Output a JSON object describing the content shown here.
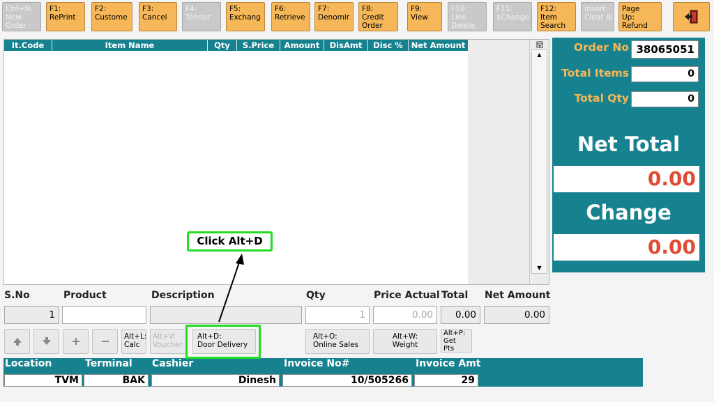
{
  "toolbar": [
    {
      "id": "new-order",
      "l1": "Ctrl+N:",
      "l2": "New",
      "l3": "Order",
      "disabled": true
    },
    {
      "id": "reprint",
      "l1": "F1:",
      "l2": "RePrint",
      "l3": "",
      "disabled": false
    },
    {
      "id": "customer",
      "l1": "F2:",
      "l2": "Custome",
      "l3": "",
      "disabled": false
    },
    {
      "id": "cancel",
      "l1": "F3:",
      "l2": "Cancel",
      "l3": "",
      "disabled": false
    },
    {
      "id": "tender",
      "l1": "F4:",
      "l2": "Tender",
      "l3": "",
      "disabled": true
    },
    {
      "id": "exchange",
      "l1": "F5:",
      "l2": "Exchang",
      "l3": "",
      "disabled": false
    },
    {
      "id": "retrieve",
      "l1": "F6:",
      "l2": "Retrieve",
      "l3": "",
      "disabled": false
    },
    {
      "id": "denomination",
      "l1": "F7:",
      "l2": "Denomir",
      "l3": "",
      "disabled": false
    },
    {
      "id": "credit-order",
      "l1": "F8:",
      "l2": "Credit",
      "l3": "Order",
      "disabled": false
    },
    {
      "id": "view",
      "l1": "F9:",
      "l2": "View",
      "l3": "",
      "disabled": false
    },
    {
      "id": "line-delete",
      "l1": "F10:",
      "l2": "Line",
      "l3": "Delete",
      "disabled": true
    },
    {
      "id": "change",
      "l1": "F11:",
      "l2": "$Change",
      "l3": "",
      "disabled": true
    },
    {
      "id": "item-search",
      "l1": "F12:",
      "l2": "Item",
      "l3": "Search",
      "disabled": false
    },
    {
      "id": "clear-all",
      "l1": "Insert:",
      "l2": "Clear All",
      "l3": "",
      "disabled": true
    },
    {
      "id": "refund",
      "l1": "Page",
      "l2": "Up:",
      "l3": "Refund",
      "disabled": false
    }
  ],
  "grid": {
    "columns": [
      "It.Code",
      "Item Name",
      "Qty",
      "S.Price",
      "Amount",
      "DisAmt",
      "Disc %",
      "Net Amount"
    ]
  },
  "right_panel": {
    "order_no_label": "Order No",
    "order_no_value": "38065051",
    "total_items_label": "Total Items",
    "total_items_value": "0",
    "total_qty_label": "Total Qty",
    "total_qty_value": "0",
    "net_total_label": "Net Total",
    "net_total_value": "0.00",
    "change_label": "Change",
    "change_value": "0.00"
  },
  "entry": {
    "labels": {
      "sno": "S.No",
      "product": "Product",
      "description": "Description",
      "qty": "Qty",
      "price_actual": "Price Actual",
      "total": "Total",
      "net_amount": "Net Amount"
    },
    "values": {
      "sno": "1",
      "product": "",
      "description": "",
      "qty": "1",
      "price_actual": "0.00",
      "total": "0.00",
      "net_amount": "0.00"
    }
  },
  "shortcuts": {
    "calc": {
      "l1": "Alt+L:",
      "l2": "Calc"
    },
    "voucher": {
      "l1": "Alt+V:",
      "l2": "Voucher"
    },
    "door_delivery": {
      "l1": "Alt+D:",
      "l2": "Door Delivery"
    },
    "online_sales": {
      "l1": "Alt+O:",
      "l2": "Online Sales"
    },
    "weight": {
      "l1": "Alt+W:",
      "l2": "Weight"
    },
    "get_pts": {
      "l1": "Alt+P:",
      "l2": "Get",
      "l3": "Pts"
    }
  },
  "status": {
    "location_label": "Location",
    "location_value": "TVM",
    "terminal_label": "Terminal",
    "terminal_value": "BAK",
    "cashier_label": "Cashier",
    "cashier_value": "Dinesh",
    "invoice_no_label": "Invoice No#",
    "invoice_no_value": "10/505266",
    "invoice_amt_label": "Invoice Amt",
    "invoice_amt_value": "29"
  },
  "callout": "Click Alt+D",
  "colors": {
    "teal": "#17828f",
    "orange_button": "#f5b757",
    "amount_red": "#e14b33",
    "highlight_green": "#22dd22"
  },
  "icons": {
    "exit": "exit-icon",
    "up": "up-arrow-icon",
    "down": "down-arrow-icon",
    "plus": "plus-icon",
    "minus": "minus-icon"
  }
}
